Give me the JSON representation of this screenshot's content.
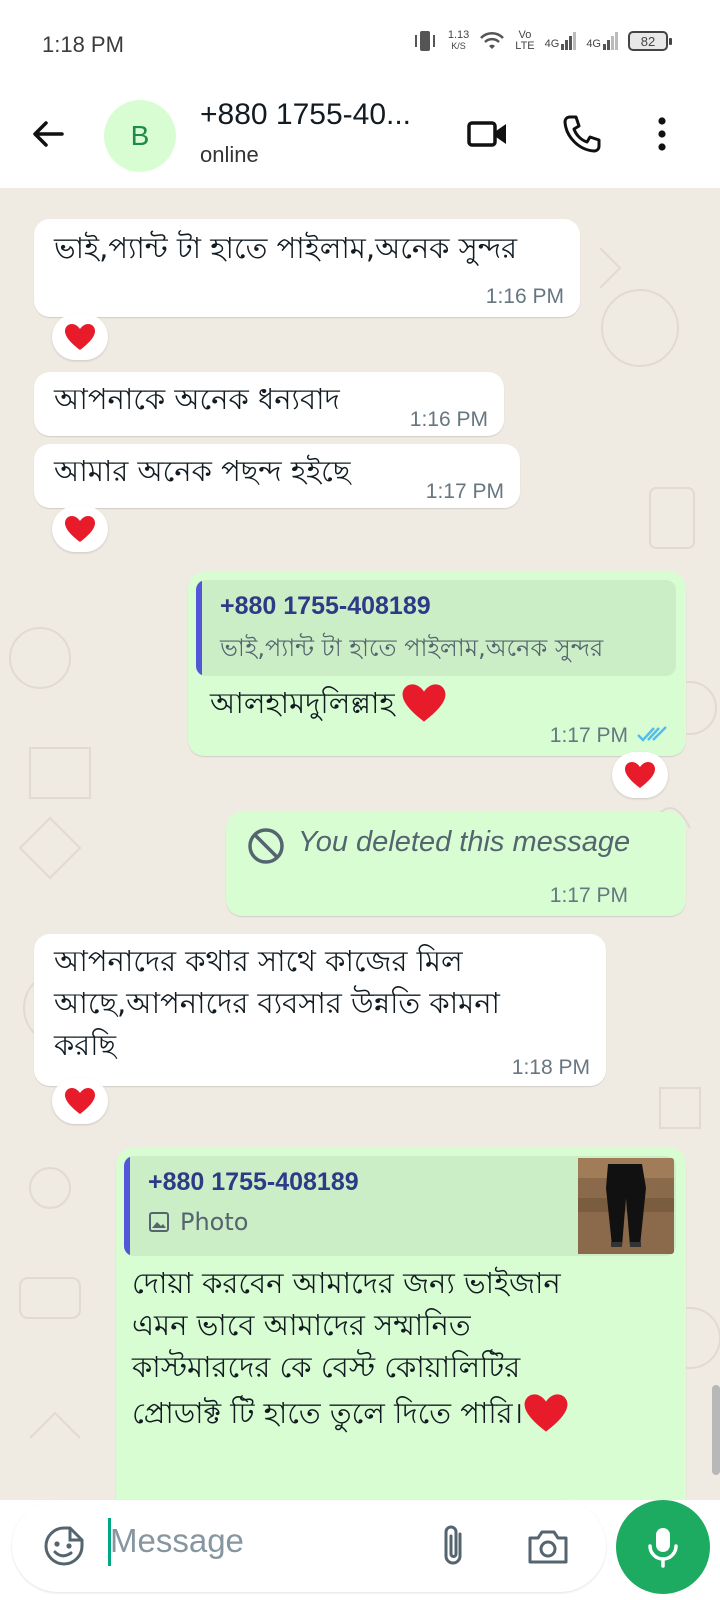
{
  "status_bar": {
    "time": "1:18 PM",
    "net_speed_value": "1.13",
    "net_speed_unit": "K/S",
    "volte_top": "Vo",
    "volte_bottom": "LTE",
    "sim1": "4G",
    "sim2": "4G",
    "battery": "82"
  },
  "header": {
    "avatar_letter": "B",
    "contact_name": "+880 1755-40...",
    "contact_status": "online"
  },
  "messages": [
    {
      "direction": "incoming",
      "text": "ভাই,প্যান্ট টা হাতে পাইলাম,অনেক সুন্দর",
      "time": "1:16 PM",
      "reaction": "heart"
    },
    {
      "direction": "incoming",
      "text": "আপনাকে অনেক ধন্যবাদ",
      "time": "1:16 PM"
    },
    {
      "direction": "incoming",
      "text": "আমার অনেক পছন্দ হইছে",
      "time": "1:17 PM",
      "reaction": "heart"
    },
    {
      "direction": "outgoing",
      "quote": {
        "name": "+880 1755-408189",
        "text": "ভাই,প্যান্ট টা হাতে পাইলাম,অনেক সুন্দর"
      },
      "text": "আলহামদুলিল্লাহ",
      "time": "1:17 PM",
      "reaction": "heart",
      "status": "read"
    },
    {
      "direction": "outgoing",
      "deleted_text": "You deleted this message",
      "time": "1:17 PM"
    },
    {
      "direction": "incoming",
      "lines": [
        "আপনাদের কথার সাথে কাজের মিল",
        "আছে,আপনাদের ব্যবসার উন্নতি কামনা",
        "করছি"
      ],
      "time": "1:18 PM",
      "reaction": "heart"
    },
    {
      "direction": "outgoing",
      "quote": {
        "name": "+880 1755-408189",
        "text": "Photo"
      },
      "lines": [
        "দোয়া করবেন আমাদের জন্য ভাইজান",
        "এমন ভাবে আমাদের সম্মানিত",
        "কাস্টমারদের কে বেস্ট কোয়ালিটির",
        "প্রোডাক্ট টি হাতে তুলে দিতে পারি।"
      ]
    }
  ],
  "composer": {
    "placeholder": "Message"
  },
  "icons": {
    "back": "arrow-left-icon",
    "video": "video-call-icon",
    "call": "phone-icon",
    "menu": "more-vert-icon",
    "emoji": "sticker-smiley-icon",
    "attach": "paperclip-icon",
    "camera": "camera-icon",
    "mic": "microphone-icon"
  },
  "colors": {
    "outgoing_bubble": "#d9fdd3",
    "incoming_bubble": "#ffffff",
    "chat_background": "#efeae2",
    "accent_green": "#1daa61",
    "read_tick": "#53bdeb",
    "quote_bar": "#5157d6"
  }
}
